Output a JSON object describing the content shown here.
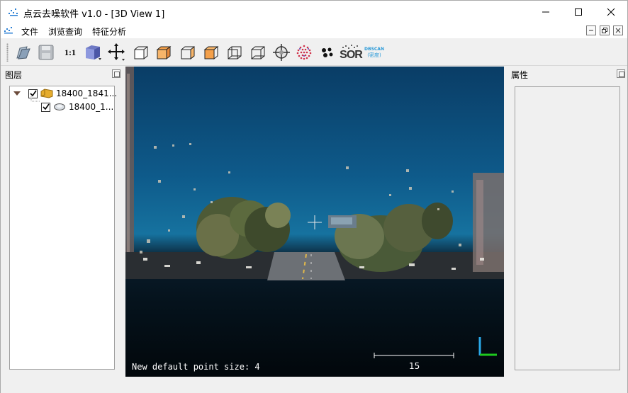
{
  "window": {
    "title": "点云去噪软件 v1.0 - [3D View 1]",
    "controls": [
      "minimize",
      "maximize",
      "close"
    ]
  },
  "menu": {
    "items": [
      "文件",
      "浏览查询",
      "特征分析"
    ]
  },
  "toolbar": {
    "items": [
      {
        "name": "open-icon"
      },
      {
        "name": "save-icon"
      },
      {
        "name": "zoom-1to1",
        "label": "1:1"
      },
      {
        "name": "view-cube-icon"
      },
      {
        "name": "move-icon"
      },
      {
        "name": "view-front-icon"
      },
      {
        "name": "view-top-icon"
      },
      {
        "name": "view-left-icon"
      },
      {
        "name": "view-right-icon"
      },
      {
        "name": "view-back-icon"
      },
      {
        "name": "view-bottom-icon"
      },
      {
        "name": "pick-icon"
      },
      {
        "name": "points-icon"
      },
      {
        "name": "clusters-icon"
      },
      {
        "name": "sor-filter",
        "label": "SOR"
      },
      {
        "name": "dbscan-filter",
        "label": "DBSCAN",
        "sublabel": "(密度)"
      }
    ]
  },
  "layers_panel": {
    "title": "图层",
    "items": [
      {
        "label": "18400_1841...",
        "checked": true,
        "expanded": true,
        "type": "folder"
      },
      {
        "label": "18400_1...",
        "checked": true,
        "type": "cloud"
      }
    ]
  },
  "properties_panel": {
    "title": "属性"
  },
  "view3d": {
    "message": "New default point size: 4",
    "scale_value": "15"
  }
}
